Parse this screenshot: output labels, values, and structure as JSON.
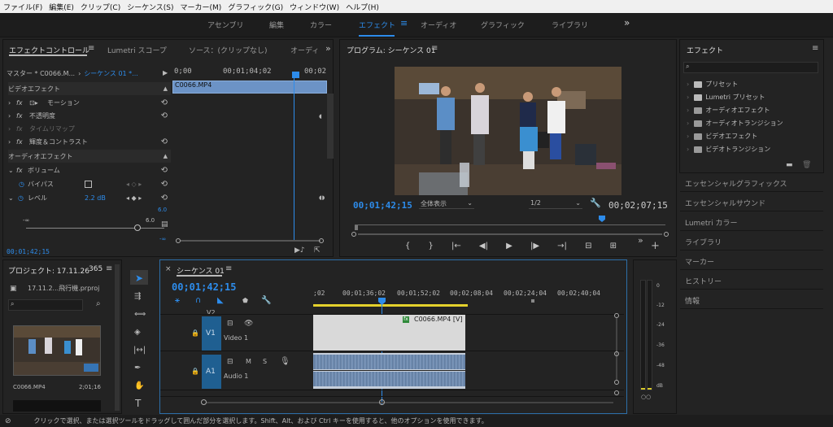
{
  "menu": [
    "ファイル(F)",
    "編集(E)",
    "クリップ(C)",
    "シーケンス(S)",
    "マーカー(M)",
    "グラフィック(G)",
    "ウィンドウ(W)",
    "ヘルプ(H)"
  ],
  "workspaces": [
    "アセンブリ",
    "編集",
    "カラー",
    "エフェクト",
    "オーディオ",
    "グラフィック",
    "ライブラリ"
  ],
  "workspace_active": "エフェクト",
  "more": "»",
  "effect_controls": {
    "tabs": [
      "エフェクトコントロール",
      "Lumetri スコープ",
      "ソース：(クリップなし)",
      "オーディ"
    ],
    "master": "マスター * C0066.M...",
    "sequence": "シーケンス 01 *...",
    "ruler": [
      "0;00",
      "00;01;04;02",
      "00;02"
    ],
    "clip_label": "C0066.MP4",
    "video_section": "ビデオエフェクト",
    "motion": "モーション",
    "opacity": "不透明度",
    "timeremap": "タイムリマップ",
    "brightness": "輝度＆コントラスト",
    "audio_section": "オーディオエフェクト",
    "volume": "ボリューム",
    "bypass": "バイパス",
    "level": "レベル",
    "level_value": "2.2 dB",
    "scale_max": "6.0",
    "scale_min": "-∞",
    "scale_right": "6.0",
    "scale_bottom": "-∞",
    "timecode": "00;01;42;15",
    "fx": "fx"
  },
  "program": {
    "title": "プログラム: シーケンス 01",
    "timecode": "00;01;42;15",
    "fit": "全体表示",
    "quality": "1/2",
    "duration": "00;02;07;15",
    "controls": [
      "{",
      "}",
      "|←",
      "◀|",
      "▶",
      "|▶",
      "→|",
      "⊟",
      "⊞"
    ]
  },
  "effects": {
    "title": "エフェクト",
    "items": [
      "プリセット",
      "Lumetri プリセット",
      "オーディオエフェクト",
      "オーディオトランジション",
      "ビデオエフェクト",
      "ビデオトランジション"
    ]
  },
  "essentials": [
    "エッセンシャルグラフィックス",
    "エッセンシャルサウンド",
    "Lumetri カラー",
    "ライブラリ",
    "マーカー",
    "ヒストリー",
    "情報"
  ],
  "project": {
    "title": "プロジェクト: 17.11.26",
    "count": "365",
    "file": "17.11.2...飛行機.prproj",
    "clip_name": "C0066.MP4",
    "clip_duration": "2;01;16"
  },
  "timeline": {
    "title": "シーケンス 01",
    "timecode": "00;01;42;15",
    "ruler": [
      ";02",
      "00;01;36;02",
      "00;01;52;02",
      "00;02;08;04",
      "00;02;24;04",
      "00;02;40;04"
    ],
    "v2": "V2",
    "v1": "V1",
    "v1_name": "Video 1",
    "a1": "A1",
    "a1_name": "Audio 1",
    "clip": "C0066.MP4 [V]",
    "m": "M",
    "s": "S"
  },
  "meter": {
    "ticks": [
      "0",
      "-12",
      "-24",
      "-36",
      "-48",
      "dB"
    ],
    "bottom": "○○"
  },
  "status": "クリックで選択、または選択ツールをドラッグして囲んだ部分を選択します。Shift、Alt、および Ctrl キーを使用すると、他のオプションを使用できます。"
}
